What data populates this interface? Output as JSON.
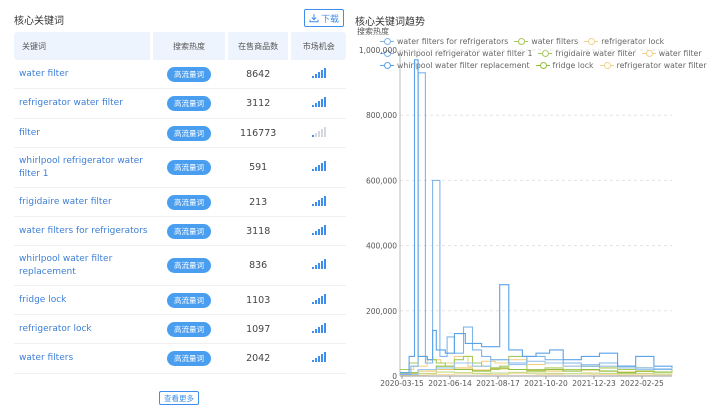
{
  "left": {
    "title": "核心关键词",
    "download_label": "下载",
    "columns": {
      "keyword": "关键词",
      "heat": "搜索热度",
      "goods": "在售商品数",
      "opportunity": "市场机会"
    },
    "rows": [
      {
        "keyword": "water filter",
        "heat": "高流量词",
        "goods": "8642",
        "opportunity": 5
      },
      {
        "keyword": "refrigerator water filter",
        "heat": "高流量词",
        "goods": "3112",
        "opportunity": 5
      },
      {
        "keyword": "filter",
        "heat": "高流量词",
        "goods": "116773",
        "opportunity": 1
      },
      {
        "keyword": "whirlpool refrigerator water filter 1",
        "heat": "高流量词",
        "goods": "591",
        "opportunity": 5
      },
      {
        "keyword": "frigidaire water filter",
        "heat": "高流量词",
        "goods": "213",
        "opportunity": 5
      },
      {
        "keyword": "water filters for refrigerators",
        "heat": "高流量词",
        "goods": "3118",
        "opportunity": 5
      },
      {
        "keyword": "whirlpool water filter replacement",
        "heat": "高流量词",
        "goods": "836",
        "opportunity": 5
      },
      {
        "keyword": "fridge lock",
        "heat": "高流量词",
        "goods": "1103",
        "opportunity": 5
      },
      {
        "keyword": "refrigerator lock",
        "heat": "高流量词",
        "goods": "1097",
        "opportunity": 5
      },
      {
        "keyword": "water filters",
        "heat": "高流量词",
        "goods": "2042",
        "opportunity": 5
      }
    ],
    "more_label": "查看更多",
    "colors": {
      "accent": "#3d8eed",
      "badge": "#4a9ef0",
      "header_bg": "#edf4fd",
      "link": "#3d7fd6"
    }
  },
  "right": {
    "title": "核心关键词趋势",
    "legend_title": "搜索热度",
    "legend_rows": [
      [
        {
          "name": "water filters for refrigerators",
          "color": "#7fb6ea"
        },
        {
          "name": "water filters",
          "color": "#a6c95a"
        },
        {
          "name": "refrigerator lock",
          "color": "#f2d28a"
        }
      ],
      [
        {
          "name": "whirlpool refrigerator water filter 1",
          "color": "#7fb6ea"
        },
        {
          "name": "frigidaire water filter",
          "color": "#a6c95a"
        },
        {
          "name": "water filter",
          "color": "#f2d28a"
        }
      ],
      [
        {
          "name": "whirlpool water filter replacement",
          "color": "#5aa3e8"
        },
        {
          "name": "fridge lock",
          "color": "#8fbf3a"
        },
        {
          "name": "refrigerator water filter",
          "color": "#f2d28a"
        }
      ]
    ]
  },
  "chart_data": {
    "type": "line",
    "ylim": [
      0,
      1000000
    ],
    "y_ticks": [
      0,
      200000,
      400000,
      600000,
      800000,
      1000000
    ],
    "y_tick_labels": [
      "0",
      "200,000",
      "400,000",
      "600,000",
      "800,000",
      "1,000,000"
    ],
    "x_ticks": [
      "2020-03-15",
      "2021-06-14",
      "2021-08-17",
      "2021-10-20",
      "2021-12-23",
      "2022-02-25"
    ],
    "x_range": [
      0,
      300
    ],
    "grid": true,
    "legend": "top",
    "series": [
      {
        "name": "whirlpool water filter replacement",
        "color": "#5aa3e8",
        "x": [
          0,
          10,
          16,
          20,
          30,
          36,
          40,
          50,
          60,
          72,
          90,
          110,
          120,
          135,
          150,
          165,
          180,
          200,
          220,
          240,
          260,
          280,
          300
        ],
        "y": [
          10000,
          60000,
          970000,
          60000,
          50000,
          140000,
          80000,
          70000,
          130000,
          100000,
          90000,
          280000,
          80000,
          60000,
          70000,
          80000,
          50000,
          60000,
          70000,
          30000,
          60000,
          30000,
          25000
        ]
      },
      {
        "name": "water filters for refrigerators",
        "color": "#7fb6ea",
        "x": [
          0,
          12,
          20,
          28,
          36,
          44,
          52,
          60,
          70,
          80,
          90,
          100,
          120,
          140,
          160,
          180,
          200,
          220,
          240,
          260,
          280,
          300
        ],
        "y": [
          5000,
          30000,
          930000,
          40000,
          600000,
          60000,
          120000,
          70000,
          150000,
          80000,
          60000,
          50000,
          40000,
          60000,
          50000,
          40000,
          30000,
          40000,
          30000,
          25000,
          20000,
          20000
        ]
      },
      {
        "name": "whirlpool refrigerator water filter 1",
        "color": "#9cc6ee",
        "x": [
          0,
          20,
          40,
          60,
          80,
          100,
          120,
          140,
          160,
          180,
          200,
          220,
          240,
          260,
          280,
          300
        ],
        "y": [
          5000,
          20000,
          25000,
          40000,
          30000,
          50000,
          35000,
          45000,
          40000,
          30000,
          35000,
          30000,
          25000,
          20000,
          22000,
          20000
        ]
      },
      {
        "name": "water filters",
        "color": "#a6c95a",
        "x": [
          0,
          10,
          20,
          30,
          40,
          50,
          60,
          70,
          80,
          90,
          100,
          110,
          120,
          140,
          160,
          180,
          200,
          220,
          240,
          260,
          280,
          300
        ],
        "y": [
          20000,
          40000,
          60000,
          50000,
          40000,
          30000,
          50000,
          60000,
          40000,
          30000,
          20000,
          30000,
          60000,
          20000,
          25000,
          20000,
          30000,
          25000,
          20000,
          25000,
          20000,
          15000
        ]
      },
      {
        "name": "frigidaire water filter",
        "color": "#8fbf3a",
        "x": [
          0,
          20,
          40,
          60,
          80,
          100,
          120,
          140,
          160,
          180,
          200,
          220,
          240,
          260,
          280,
          300
        ],
        "y": [
          10000,
          20000,
          30000,
          20000,
          15000,
          25000,
          20000,
          15000,
          20000,
          15000,
          20000,
          15000,
          10000,
          15000,
          12000,
          10000
        ]
      },
      {
        "name": "fridge lock",
        "color": "#c6d98a",
        "x": [
          0,
          20,
          40,
          60,
          80,
          100,
          120,
          140,
          160,
          180,
          200,
          220,
          240,
          260,
          280,
          300
        ],
        "y": [
          5000,
          8000,
          12000,
          10000,
          8000,
          9000,
          11000,
          9000,
          8000,
          7000,
          9000,
          8000,
          7000,
          8000,
          6000,
          6000
        ]
      },
      {
        "name": "water filter",
        "color": "#f2d28a",
        "x": [
          0,
          15,
          30,
          45,
          60,
          75,
          90,
          105,
          120,
          140,
          160,
          180,
          200,
          220,
          240,
          260,
          280,
          300
        ],
        "y": [
          20000,
          30000,
          50000,
          40000,
          60000,
          30000,
          45000,
          40000,
          50000,
          35000,
          40000,
          30000,
          35000,
          30000,
          25000,
          20000,
          20000,
          18000
        ]
      },
      {
        "name": "refrigerator lock",
        "color": "#f6dea5",
        "x": [
          0,
          30,
          60,
          90,
          120,
          150,
          180,
          210,
          240,
          270,
          300
        ],
        "y": [
          3000,
          5000,
          6000,
          5000,
          7000,
          5000,
          6000,
          5000,
          4000,
          4000,
          3000
        ]
      },
      {
        "name": "refrigerator water filter",
        "color": "#e9c56b",
        "x": [
          0,
          20,
          40,
          60,
          80,
          100,
          120,
          140,
          160,
          180,
          200,
          220,
          240,
          260,
          280,
          300
        ],
        "y": [
          8000,
          15000,
          20000,
          25000,
          18000,
          22000,
          20000,
          18000,
          15000,
          20000,
          18000,
          15000,
          12000,
          14000,
          12000,
          10000
        ]
      }
    ]
  }
}
